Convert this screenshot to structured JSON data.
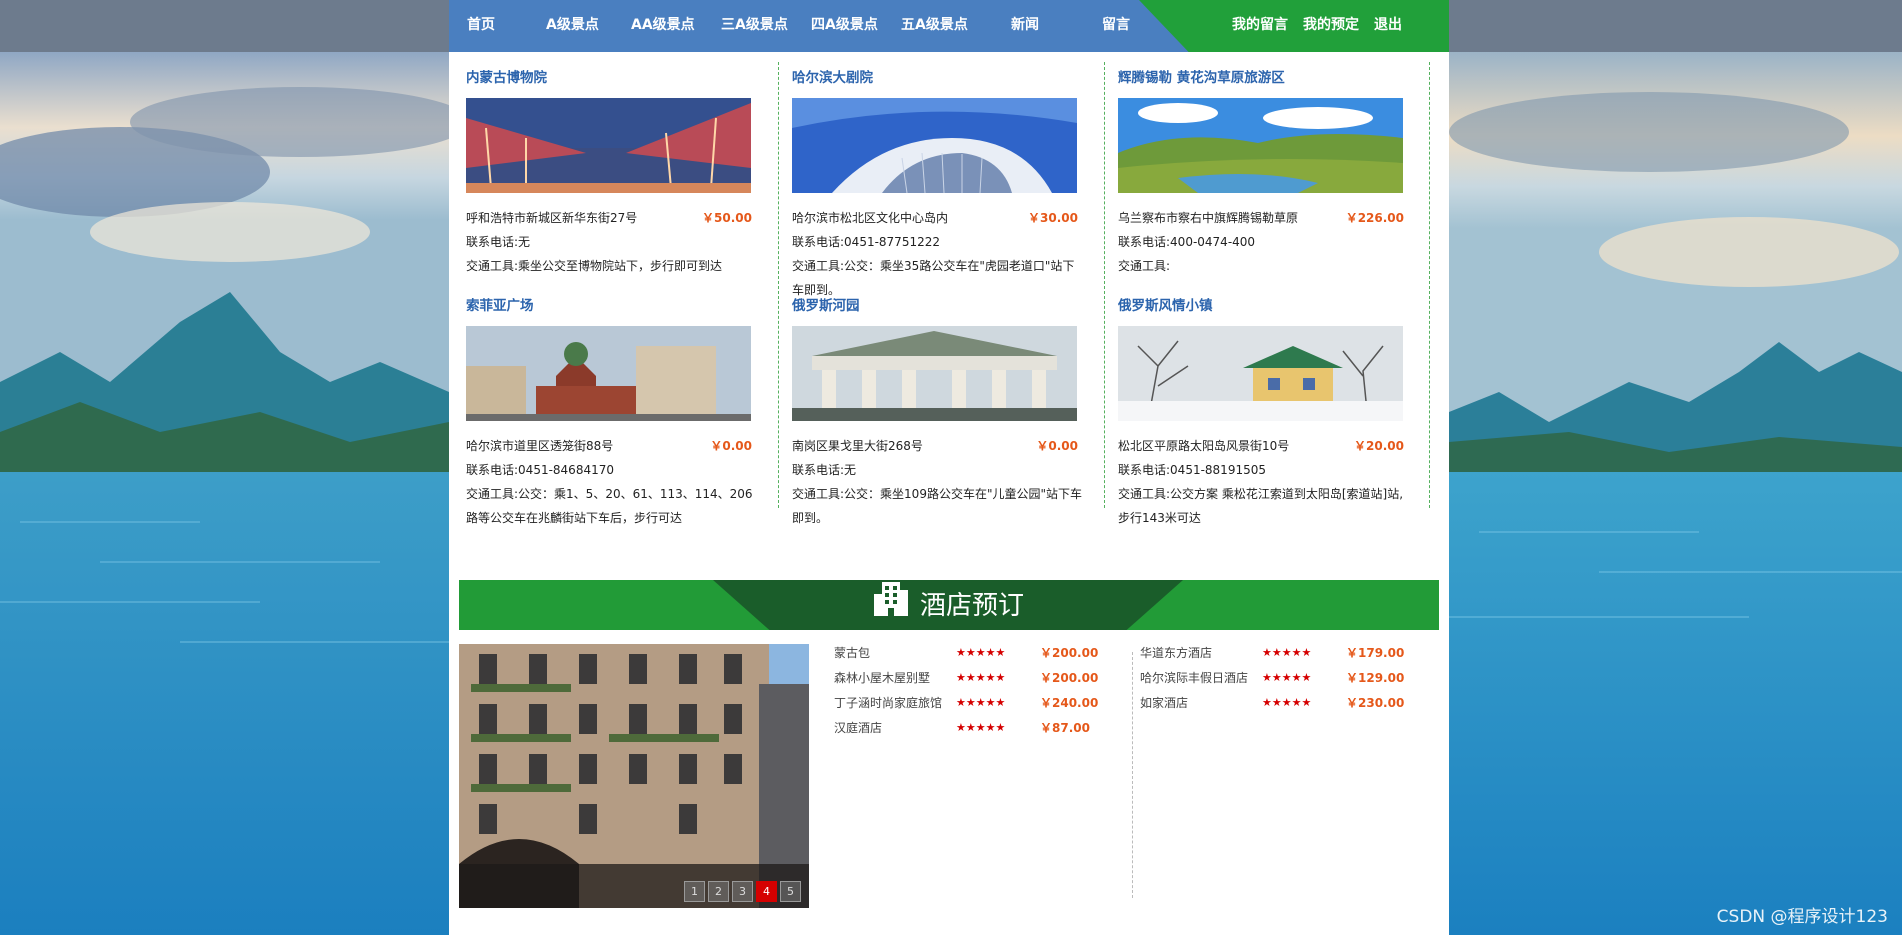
{
  "nav": {
    "left": [
      "首页",
      "A级景点",
      "AA级景点",
      "三A级景点",
      "四A级景点",
      "五A级景点",
      "新闻",
      "留言"
    ],
    "right": [
      "我的留言",
      "我的预定",
      "退出"
    ]
  },
  "attractions": [
    {
      "title": "内蒙古博物院",
      "address": "呼和浩特市新城区新华东街27号",
      "price": "￥50.00",
      "phone": "联系电话:无",
      "transport": "交通工具:乘坐公交至博物院站下，步行即可到达"
    },
    {
      "title": "哈尔滨大剧院",
      "address": "哈尔滨市松北区文化中心岛内",
      "price": "￥30.00",
      "phone": "联系电话:0451-87751222",
      "transport": "交通工具:公交：乘坐35路公交车在\"虎园老道口\"站下车即到。"
    },
    {
      "title": "辉腾锡勒 黄花沟草原旅游区",
      "address": "乌兰察布市察右中旗辉腾锡勒草原",
      "price": "￥226.00",
      "phone": "联系电话:400-0474-400",
      "transport": "交通工具:"
    },
    {
      "title": "索菲亚广场",
      "address": "哈尔滨市道里区透笼街88号",
      "price": "￥0.00",
      "phone": "联系电话:0451-84684170",
      "transport": "交通工具:公交：乘1、5、20、61、113、114、206路等公交车在兆麟街站下车后，步行可达"
    },
    {
      "title": "俄罗斯河园",
      "address": "南岗区果戈里大街268号",
      "price": "￥0.00",
      "phone": "联系电话:无",
      "transport": "交通工具:公交：乘坐109路公交车在\"儿童公园\"站下车即到。"
    },
    {
      "title": "俄罗斯风情小镇",
      "address": "松北区平原路太阳岛风景街10号",
      "price": "￥20.00",
      "phone": "联系电话:0451-88191505",
      "transport": "交通工具:公交方案 乘松花江索道到太阳岛[索道站]站,步行143米可达"
    }
  ],
  "hotel_section": {
    "title": "酒店预订",
    "pager": [
      "1",
      "2",
      "3",
      "4",
      "5"
    ],
    "pager_active": "4",
    "left_list": [
      {
        "name": "蒙古包",
        "stars": "★★★★★",
        "price": "￥200.00"
      },
      {
        "name": "森林小屋木屋别墅",
        "stars": "★★★★★",
        "price": "￥200.00"
      },
      {
        "name": "丁子涵时尚家庭旅馆",
        "stars": "★★★★★",
        "price": "￥240.00"
      },
      {
        "name": "汉庭酒店",
        "stars": "★★★★★",
        "price": "￥87.00"
      }
    ],
    "right_list": [
      {
        "name": "华道东方酒店",
        "stars": "★★★★★",
        "price": "￥179.00"
      },
      {
        "name": "哈尔滨际丰假日酒店",
        "stars": "★★★★★",
        "price": "￥129.00"
      },
      {
        "name": "如家酒店",
        "stars": "★★★★★",
        "price": "￥230.00"
      }
    ]
  },
  "watermark": "CSDN @程序设计123",
  "colors": {
    "nav_blue": "#4a7fc0",
    "nav_green": "#21a03a",
    "title_blue": "#2c64ad",
    "price_orange": "#e5581a",
    "star_red": "#d50000",
    "banner_green": "#229b37",
    "banner_dark": "#1a5d2a"
  }
}
